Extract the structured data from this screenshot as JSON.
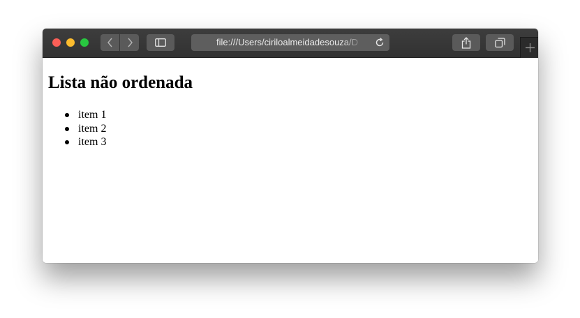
{
  "browser": {
    "address_bar": {
      "url": "file:///Users/ciriloalmeidadesouza/D"
    },
    "icons": {
      "back": "chevron-left-icon",
      "forward": "chevron-right-icon",
      "sidebar": "sidebar-icon",
      "reload": "reload-icon",
      "share": "share-icon",
      "tabs": "tabs-overview-icon",
      "new_tab": "plus-icon"
    },
    "colors": {
      "close": "#fc5f57",
      "minimize": "#fdbc2e",
      "maximize": "#28c840",
      "toolbar": "#353535"
    }
  },
  "page": {
    "heading": "Lista não ordenada",
    "items": [
      "item 1",
      "item 2",
      "item 3"
    ]
  }
}
